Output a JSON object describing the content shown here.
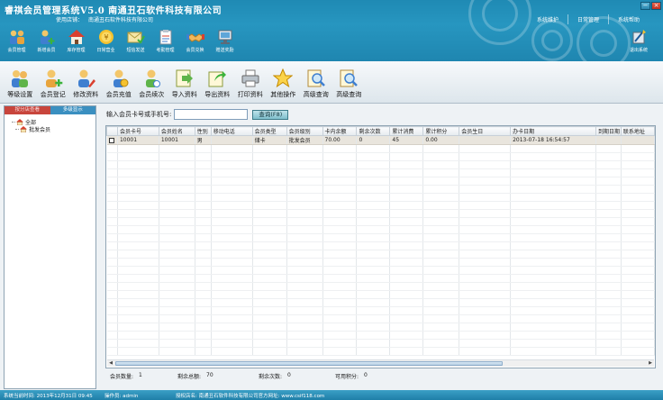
{
  "app": {
    "title": "睿祺会员管理系统V5.0  南通丑石软件科技有限公司",
    "store_label": "使用店铺：",
    "store_name": "南通丑石软件科技有限公司"
  },
  "header_links": [
    "系统维护",
    "日常管理",
    "系统帮助"
  ],
  "window_controls": [
    "−",
    "×"
  ],
  "top_nav": [
    {
      "label": "会员管理",
      "icon": "members-icon"
    },
    {
      "label": "新增会员",
      "icon": "add-member-icon"
    },
    {
      "label": "库存管理",
      "icon": "house-icon"
    },
    {
      "label": "日常营业",
      "icon": "coin-icon"
    },
    {
      "label": "短信发送",
      "icon": "envelope-icon"
    },
    {
      "label": "考勤管理",
      "icon": "checklist-icon"
    },
    {
      "label": "会员兑换",
      "icon": "handshake-icon"
    },
    {
      "label": "赠送奖励",
      "icon": "monitor-icon"
    }
  ],
  "switch_system": {
    "label": "退出系统",
    "icon": "exit-icon"
  },
  "toolbar": [
    {
      "label": "等级设置",
      "icon": "level-icon"
    },
    {
      "label": "会员登记",
      "icon": "register-icon"
    },
    {
      "label": "修改资料",
      "icon": "edit-user-icon"
    },
    {
      "label": "会员充值",
      "icon": "recharge-icon"
    },
    {
      "label": "会员续次",
      "icon": "renew-icon"
    },
    {
      "label": "导入资料",
      "icon": "import-icon"
    },
    {
      "label": "导出资料",
      "icon": "export-icon"
    },
    {
      "label": "打印资料",
      "icon": "printer-icon"
    },
    {
      "label": "其他操作",
      "icon": "star-icon"
    },
    {
      "label": "高级查询",
      "icon": "search-doc-icon"
    },
    {
      "label": "高级查询",
      "icon": "search-doc-icon"
    }
  ],
  "left_panel": {
    "tabs": [
      "按分店查看",
      "多级显示"
    ],
    "tree": [
      {
        "label": "全部",
        "level": 0
      },
      {
        "label": "批发会员",
        "level": 1
      }
    ]
  },
  "search": {
    "label": "输入会员卡号或手机号:",
    "value": "",
    "button": "查询(F8)"
  },
  "grid": {
    "columns": [
      "会员卡号",
      "会员姓名",
      "性别",
      "移动电话",
      "会员类型",
      "会员级别",
      "卡内余额",
      "剩余次数",
      "累计消费",
      "累计积分",
      "会员生日",
      "办卡日期",
      "到期日期",
      "联系地址"
    ],
    "rows": [
      [
        "10001",
        "10001",
        "男",
        "",
        "储卡",
        "批发会员",
        "70.00",
        "0",
        "45",
        "0.00",
        "",
        "2013-07-18 16:54:57",
        "",
        ""
      ]
    ],
    "blank_rows": 26
  },
  "summary": [
    {
      "label": "会员数量:",
      "value": "1"
    },
    {
      "label": "剩余总额:",
      "value": "70"
    },
    {
      "label": "剩余次数:",
      "value": "0"
    },
    {
      "label": "可用积分:",
      "value": "0"
    }
  ],
  "statusbar": {
    "login_time": "系统当前时间: 2013年12月31日 09:45",
    "operator": "操作员:   admin",
    "license": "授权店名:   南通丑石软件科技有限公司官方网址: www.csif118.com"
  },
  "colors": {
    "header_blue": "#2796c0",
    "tab_red": "#c8453c",
    "tab_blue": "#3a8fc0",
    "selected_row": "#e9e5dd"
  }
}
